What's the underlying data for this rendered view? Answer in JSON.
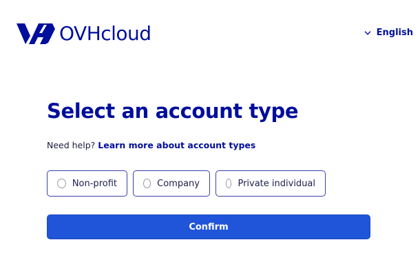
{
  "header": {
    "logo_text": "OVHcloud",
    "language": {
      "icon": "chevron-down-icon",
      "label": "English"
    }
  },
  "main": {
    "title": "Select an account type",
    "help_prefix": "Need help?",
    "help_link": "Learn more about account types",
    "account_types": [
      {
        "label": "Non-profit",
        "selected": false
      },
      {
        "label": "Company",
        "selected": false
      },
      {
        "label": "Private individual",
        "selected": false
      }
    ],
    "confirm_label": "Confirm"
  },
  "colors": {
    "brand": "#000e9c",
    "primary_button": "#2055d9",
    "tile_border": "#3b3fa8"
  }
}
